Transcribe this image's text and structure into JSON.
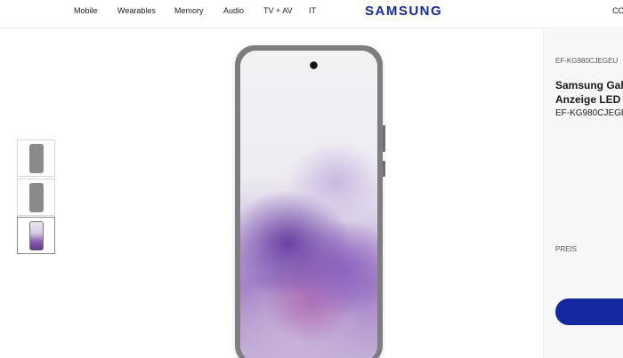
{
  "header": {
    "nav": [
      "Mobile",
      "Wearables",
      "Memory",
      "Audio",
      "TV + AV",
      "IT"
    ],
    "logo": "SAMSUNG",
    "right_text": "CO"
  },
  "gallery": {
    "thumbnails": [
      "phone-case-thumbnail",
      "phone-case-thumbnail",
      "phone-screen-thumbnail"
    ],
    "selected_index": 2
  },
  "product": {
    "sku_small": "EF-KG980CJEGEU",
    "title_line1": "Samsung Gal",
    "title_line2": "Anzeige LED",
    "sku": "EF-KG980CJEGE",
    "price_label": "PREIS"
  },
  "colors": {
    "brand": "#1428a0",
    "case": "#7e7e80"
  }
}
